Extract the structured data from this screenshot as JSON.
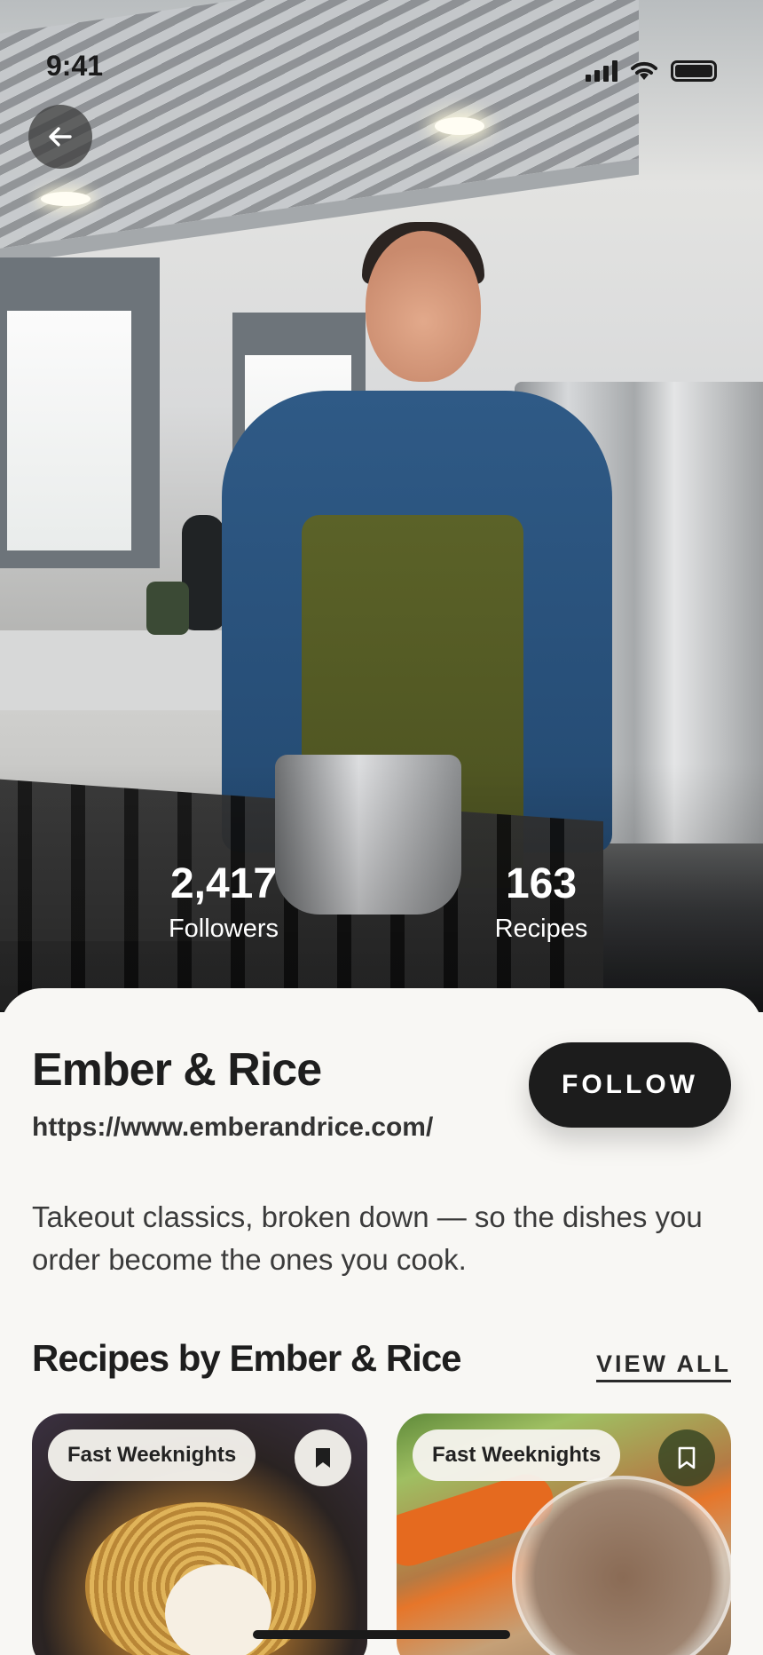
{
  "status_bar": {
    "time": "9:41"
  },
  "hero": {
    "back_icon": "arrow-left-icon",
    "stats": {
      "followers_value": "2,417",
      "followers_label": "Followers",
      "recipes_value": "163",
      "recipes_label": "Recipes"
    }
  },
  "profile": {
    "name": "Ember & Rice",
    "url": "https://www.emberandrice.com/",
    "follow_label": "FOLLOW",
    "bio": "Takeout classics, broken down — so the dishes you order become the ones you cook."
  },
  "recipes_section": {
    "title": "Recipes by Ember & Rice",
    "view_all_label": "VIEW ALL",
    "cards": [
      {
        "tag": "Fast Weeknights",
        "bookmarked": true,
        "icon": "bookmark-filled-icon"
      },
      {
        "tag": "Fast Weeknights",
        "bookmarked": false,
        "icon": "bookmark-outline-icon"
      }
    ]
  },
  "colors": {
    "card_bg": "#f8f7f4",
    "button_dark": "#1c1c1c",
    "text_primary": "#1e1e1e"
  }
}
